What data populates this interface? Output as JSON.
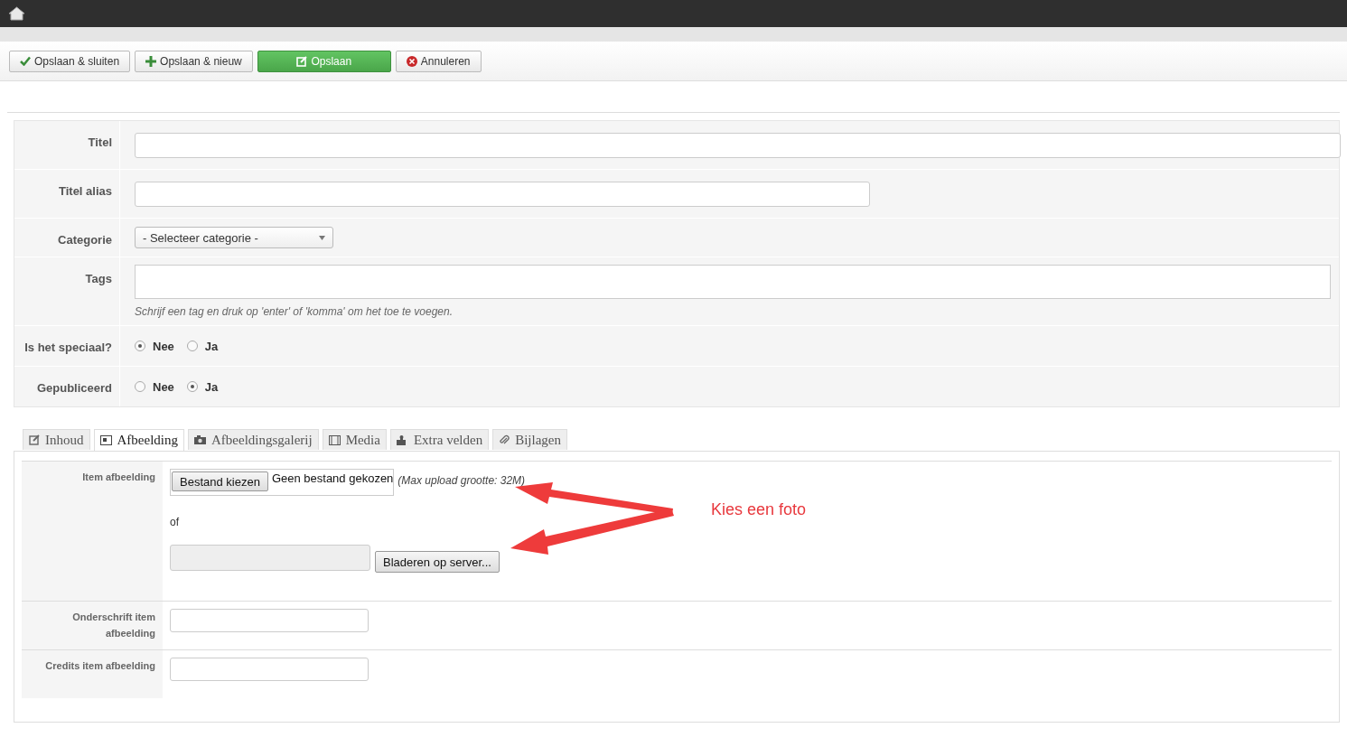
{
  "toolbar": {
    "buttons": [
      {
        "label": "Opslaan & sluiten",
        "kind": "check",
        "primary": false
      },
      {
        "label": "Opslaan & nieuw",
        "kind": "plus",
        "primary": false
      },
      {
        "label": "Opslaan",
        "kind": "edit",
        "primary": true
      },
      {
        "label": "Annuleren",
        "kind": "cancel",
        "primary": false
      }
    ]
  },
  "form": {
    "fields": [
      {
        "label": "Titel",
        "kind": "wide"
      },
      {
        "label": "Titel alias",
        "kind": "medium"
      },
      {
        "label": "Categorie",
        "kind": "select",
        "value": "- Selecteer categorie -"
      },
      {
        "label": "Tags",
        "kind": "tags",
        "hint": "Schrijf een tag en druk op 'enter' of 'komma' om het toe te voegen."
      },
      {
        "label": "Is het speciaal?",
        "kind": "radio",
        "options": [
          {
            "label": "Nee",
            "selected": true
          },
          {
            "label": "Ja",
            "selected": false
          }
        ]
      },
      {
        "label": "Gepubliceerd",
        "kind": "radio",
        "options": [
          {
            "label": "Nee",
            "selected": false
          },
          {
            "label": "Ja",
            "selected": true
          }
        ]
      }
    ]
  },
  "tabs": [
    {
      "label": "Inhoud",
      "selected": false
    },
    {
      "label": "Afbeelding",
      "selected": true
    },
    {
      "label": "Afbeeldingsgalerij",
      "selected": false
    },
    {
      "label": "Media",
      "selected": false
    },
    {
      "label": "Extra velden",
      "selected": false
    },
    {
      "label": "Bijlagen",
      "selected": false
    }
  ],
  "image_panel": {
    "rows": [
      {
        "label": "Item afbeelding",
        "kind": "upload",
        "file_button": "Bestand kiezen",
        "file_status": "Geen bestand gekozen",
        "note": "(Max upload grootte: 32M)",
        "or": "of",
        "browse_button": "Bladeren op server..."
      },
      {
        "label": "Onderschrift item afbeelding",
        "kind": "text"
      },
      {
        "label": "Credits item afbeelding",
        "kind": "text"
      }
    ]
  },
  "annotation": {
    "text": "Kies een foto"
  }
}
